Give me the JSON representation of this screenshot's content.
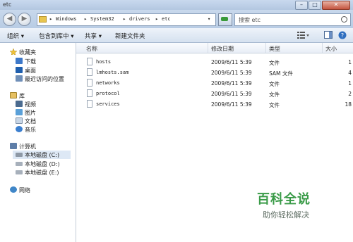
{
  "window": {
    "title": "etc",
    "min": "–",
    "max": "□",
    "close": "✕"
  },
  "address": {
    "back": "◀",
    "forward": "▶",
    "crumbs": [
      "▸",
      "Windows",
      "▸",
      "System32",
      "▸",
      "drivers",
      "▸",
      "etc"
    ],
    "dropdown": "▾",
    "search_placeholder": "搜索 etc"
  },
  "toolbar": {
    "organize": "组织 ▾",
    "include_library": "包含到库中 ▾",
    "share": "共享 ▾",
    "new_folder": "新建文件夹"
  },
  "sidebar": {
    "favorites": {
      "label": "收藏夹",
      "items": [
        "下载",
        "桌面",
        "最近访问的位置"
      ]
    },
    "libraries": {
      "label": "库",
      "items": [
        "视频",
        "图片",
        "文档",
        "音乐"
      ]
    },
    "computer": {
      "label": "计算机",
      "items": [
        "本地磁盘 (C:)",
        "本地磁盘 (D:)",
        "本地磁盘 (E:)"
      ]
    },
    "network": {
      "label": "网络"
    }
  },
  "columns": {
    "name": "名称",
    "modified": "修改日期",
    "type": "类型",
    "size": "大小"
  },
  "files": [
    {
      "name": "hosts",
      "modified": "2009/6/11 5:39",
      "type": "文件",
      "size": "1"
    },
    {
      "name": "lmhosts.sam",
      "modified": "2009/6/11 5:39",
      "type": "SAM 文件",
      "size": "4"
    },
    {
      "name": "networks",
      "modified": "2009/6/11 5:39",
      "type": "文件",
      "size": "1"
    },
    {
      "name": "protocol",
      "modified": "2009/6/11 5:39",
      "type": "文件",
      "size": "2"
    },
    {
      "name": "services",
      "modified": "2009/6/11 5:39",
      "type": "文件",
      "size": "18"
    }
  ],
  "watermark": {
    "title": "百科全说",
    "subtitle": "助你轻松解决"
  },
  "colors": {
    "accent": "#3a9b48",
    "nav_selected": "#dde8f5",
    "chrome": "#bfcfe3"
  }
}
